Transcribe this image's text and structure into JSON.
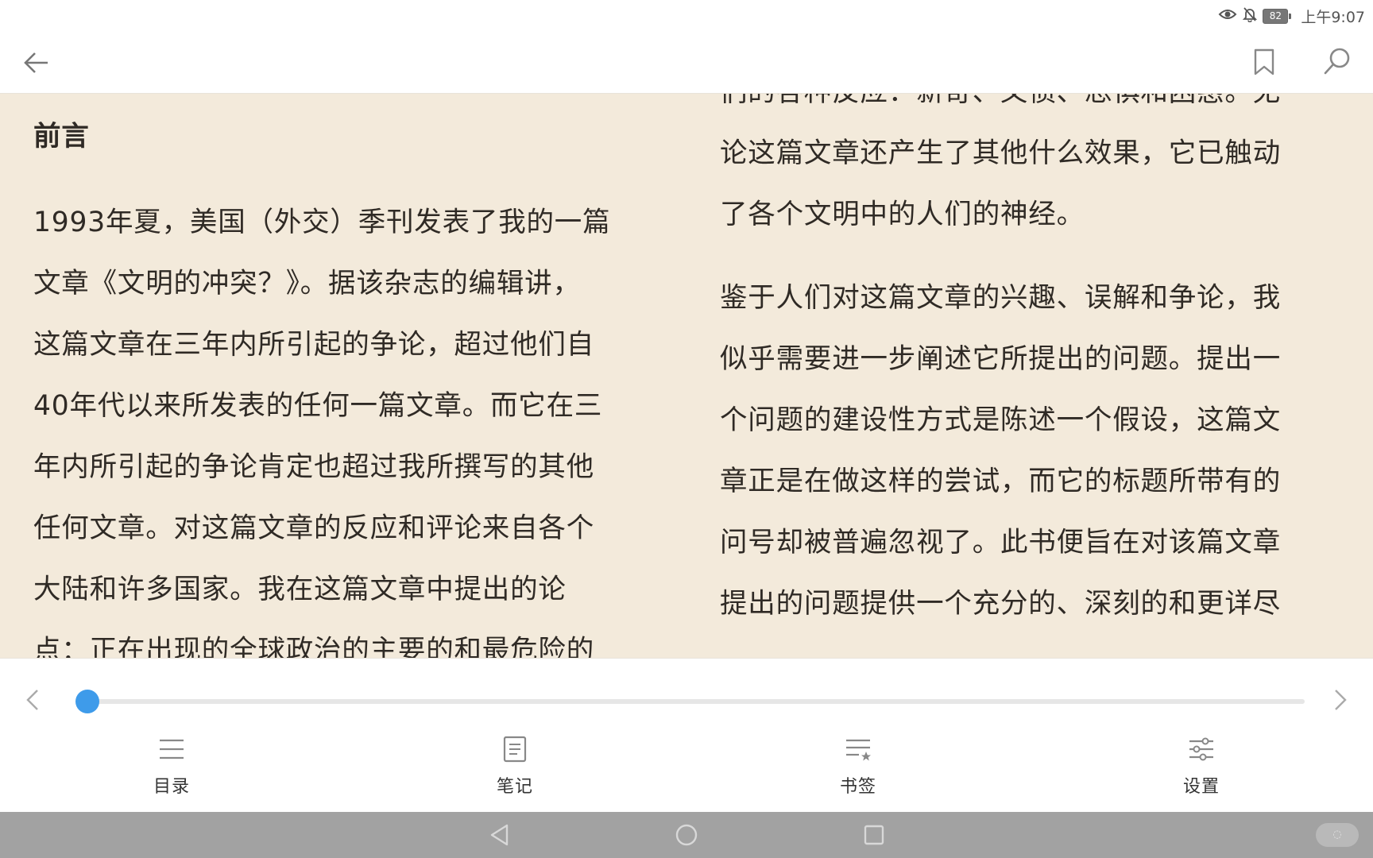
{
  "status_bar": {
    "battery": "82",
    "time": "上午9:07"
  },
  "reader": {
    "heading": "前言",
    "left_column": [
      "1993年夏，美国（外交）季刊发表了我的一篇",
      "文章《文明的冲突？》。据该杂志的编辑讲，",
      "这篇文章在三年内所引起的争论，超过他们自",
      "40年代以来所发表的任何一篇文章。而它在三",
      "年内所引起的争论肯定也超过我所撰写的其他",
      "任何文章。对这篇文章的反应和评论来自各个",
      "大陆和许多国家。我在这篇文章中提出的论",
      "点：正在出现的全球政治的主要的和最危险的"
    ],
    "right_column_para1": [
      "们的各种反应：新奇、义愤、恐惧和困惑。无",
      "论这篇文章还产生了其他什么效果，它已触动",
      "了各个文明中的人们的神经。"
    ],
    "right_column_para2": [
      "鉴于人们对这篇文章的兴趣、误解和争论，我",
      "似乎需要进一步阐述它所提出的问题。提出一",
      "个问题的建设性方式是陈述一个假设，这篇文",
      "章正是在做这样的尝试，而它的标题所带有的",
      "问号却被普遍忽视了。此书便旨在对该篇文章",
      "提出的问题提供一个充分的、深刻的和更详尽"
    ]
  },
  "progress": {
    "fraction": 0.008
  },
  "bottom_nav": {
    "toc": "目录",
    "notes": "笔记",
    "bookmarks": "书签",
    "settings": "设置"
  },
  "colors": {
    "page_bg": "#f3eadb",
    "accent": "#3e9bea",
    "text": "#2f2a25"
  }
}
